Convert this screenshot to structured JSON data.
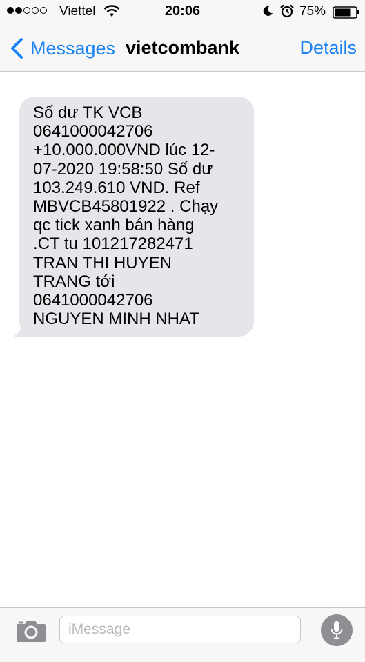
{
  "status_bar": {
    "carrier": "Viettel",
    "signal_bars_filled": 2,
    "signal_bars_total": 5,
    "time": "20:06",
    "battery_percent": "75%",
    "icons": [
      "wifi-icon",
      "moon-icon",
      "alarm-icon",
      "battery-icon"
    ]
  },
  "nav": {
    "back_label": "Messages",
    "title": "vietcombank",
    "details_label": "Details"
  },
  "messages": [
    {
      "direction": "incoming",
      "text": "Số dư TK VCB\n0641000042706\n+10.000.000VND lúc 12-\n07-2020 19:58:50 Số dư\n103.249.610 VND. Ref\nMBVCB45801922 . Chạy\nqc tick xanh bán hàng\n.CT tu 101217282471\nTRAN THI HUYEN\nTRANG tới\n0641000042706\nNGUYEN MINH NHAT"
    }
  ],
  "composer": {
    "placeholder": "iMessage",
    "value": ""
  },
  "colors": {
    "accent": "#1a83f5",
    "bubble_incoming": "#e5e5ea",
    "bar_background": "#f7f7f7",
    "mic_button": "#8e8e93"
  }
}
